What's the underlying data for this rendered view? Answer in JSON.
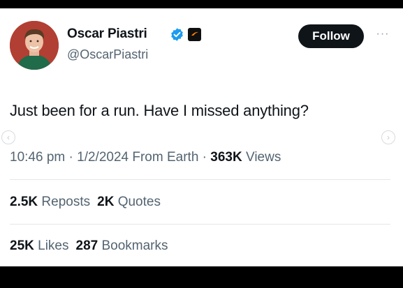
{
  "author": {
    "name": "Oscar Piastri",
    "handle": "@OscarPiastri",
    "verified_icon": "verified-badge-icon",
    "affiliation_icon": "mclaren-logo-icon"
  },
  "actions": {
    "follow_label": "Follow",
    "more_label": "···"
  },
  "tweet": {
    "text": "Just been for a run. Have I missed anything?"
  },
  "meta": {
    "time": "10:46 pm",
    "sep1": " · ",
    "date": "1/2/2024",
    "source": " From Earth",
    "sep2": " · ",
    "views_count": "363K",
    "views_label": " Views"
  },
  "stats": {
    "reposts_count": "2.5K",
    "reposts_label": "Reposts",
    "quotes_count": "2K",
    "quotes_label": "Quotes",
    "likes_count": "25K",
    "likes_label": "Likes",
    "bookmarks_count": "287",
    "bookmarks_label": "Bookmarks"
  },
  "nav": {
    "prev_glyph": "‹",
    "next_glyph": "›"
  },
  "colors": {
    "text_primary": "#0f1419",
    "text_secondary": "#536471",
    "verified_blue": "#1d9bf0",
    "follow_bg": "#0f1419",
    "avatar_bg": "#b23f33",
    "team_orange": "#ff8000"
  }
}
